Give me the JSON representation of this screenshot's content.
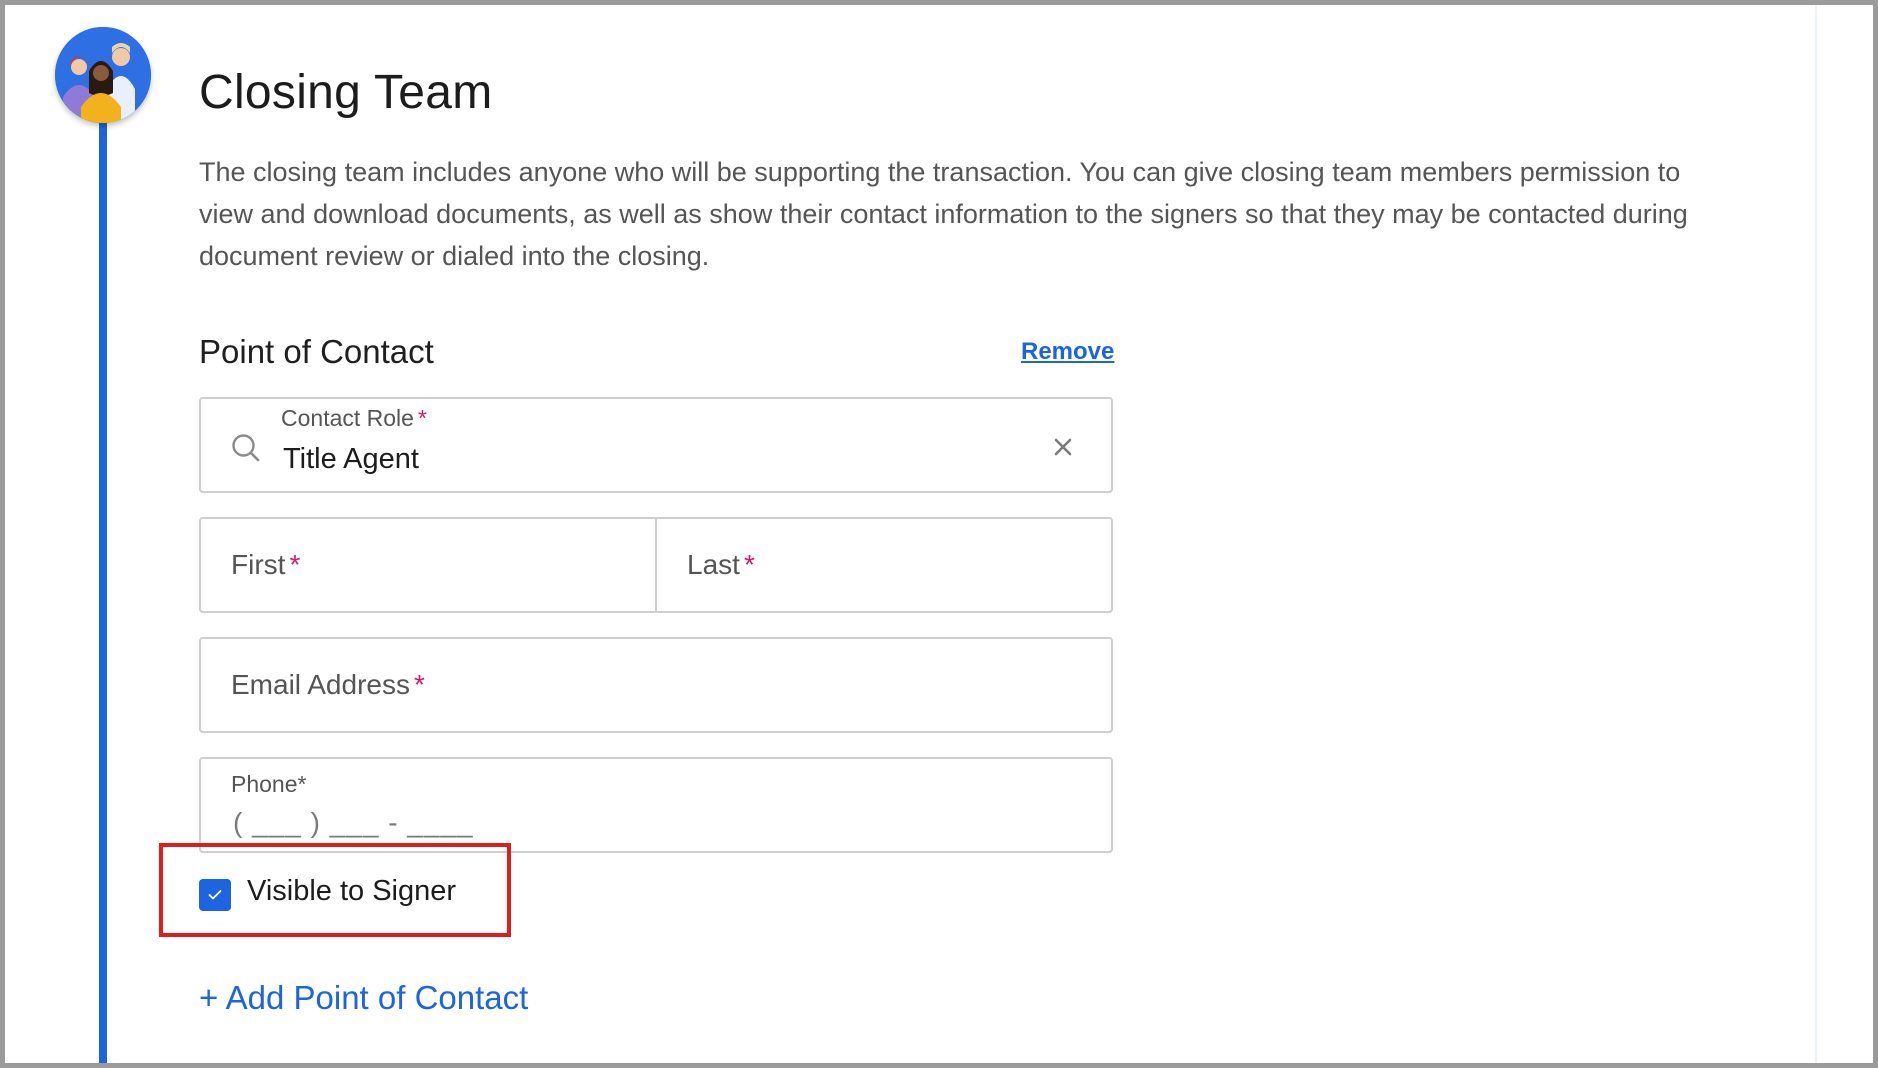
{
  "section": {
    "title": "Closing Team",
    "description": "The closing team includes anyone who will be supporting the transaction. You can give closing team members permission to view and download documents, as well as show their contact information to the signers so that they may be contacted during document review or dialed into the closing."
  },
  "point_of_contact": {
    "title": "Point of Contact",
    "remove_label": "Remove",
    "contact_role": {
      "label": "Contact Role",
      "required_mark": "*",
      "value": "Title Agent"
    },
    "first": {
      "placeholder": "First",
      "required_mark": "*"
    },
    "last": {
      "placeholder": "Last",
      "required_mark": "*"
    },
    "email": {
      "placeholder": "Email Address",
      "required_mark": "*"
    },
    "phone": {
      "label": "Phone*",
      "mask": "( ___ ) ___ - ____"
    },
    "visible_to_signer": {
      "label": "Visible to Signer",
      "checked": true
    }
  },
  "add_point_of_contact_label": "+ Add Point of Contact",
  "colors": {
    "accent": "#1d64e0",
    "required": "#d6196b",
    "highlight": "#e01d1d"
  }
}
